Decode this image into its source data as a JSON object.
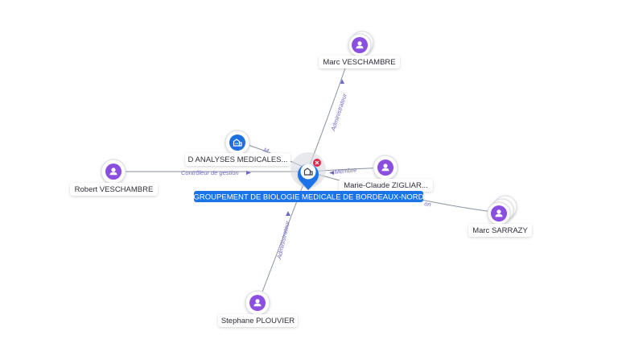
{
  "colors": {
    "person": "#8a4fe0",
    "company": "#1e6fe0",
    "center": "#1a73e8",
    "edge": "#8a93a0",
    "edge_label": "#6e67c9",
    "close": "#e0284a"
  },
  "center": {
    "label": "GROUPEMENT DE BIOLOGIE MEDICALE DE BORDEAUX-NORD",
    "icon": "building-icon"
  },
  "nodes": [
    {
      "id": "marc-veschambre",
      "label": "Marc VESCHAMBRE",
      "type": "person",
      "icon": "person-icon"
    },
    {
      "id": "d-analyses",
      "label": "D ANALYSES MEDICALES...",
      "type": "company",
      "icon": "building-icon"
    },
    {
      "id": "robert-veschambre",
      "label": "Robert VESCHAMBRE",
      "type": "person",
      "icon": "person-icon"
    },
    {
      "id": "marie-claude",
      "label": "Marie-Claude ZIGLIAR...",
      "type": "person",
      "icon": "person-icon"
    },
    {
      "id": "marc-sarrazy",
      "label": "Marc SARRAZY",
      "type": "person",
      "icon": "person-icon"
    },
    {
      "id": "stephane-plouvier",
      "label": "Stephane PLOUVIER",
      "type": "person",
      "icon": "person-icon"
    }
  ],
  "edges": [
    {
      "from": "marc-veschambre",
      "label": "Administrateur"
    },
    {
      "from": "d-analyses",
      "label": "M"
    },
    {
      "from": "robert-veschambre",
      "label": "Contrôleur de gestion"
    },
    {
      "from": "marie-claude",
      "label": "Membre"
    },
    {
      "from": "marc-sarrazy",
      "label": "on"
    },
    {
      "from": "stephane-plouvier",
      "label": "Administrateur"
    }
  ]
}
